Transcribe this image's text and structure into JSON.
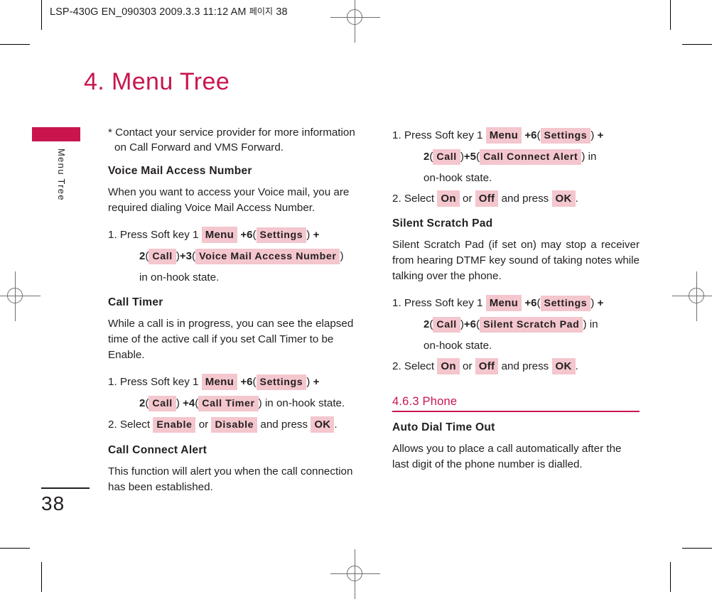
{
  "print_marks": {
    "registration_icon": "registration-crosshair-icon",
    "crop_icon": "crop-mark-icon"
  },
  "header": {
    "file_line": "LSP-430G EN_090303  2009.3.3 11:12 AM",
    "korean_page_label": "페이지",
    "page_ref": "38"
  },
  "chapter": {
    "title": "4. Menu Tree"
  },
  "side_tab": {
    "label": "Menu Tree",
    "bar_color": "#c8154d"
  },
  "folio": {
    "page_number": "38"
  },
  "colors": {
    "accent": "#c8154d",
    "highlight": "#f4c6cd",
    "text": "#231f20"
  },
  "left_column": {
    "note": "Contact your service provider for more information on Call Forward and VMS Forward.",
    "note_marker": "*",
    "sections": [
      {
        "heading": "Voice Mail Access Number",
        "body": "When you want to access your Voice mail, you are required dialing Voice Mail Access Number.",
        "step1": {
          "number": "1.",
          "lead": "Press Soft key 1",
          "k1": "Menu",
          "plus1": "+",
          "d1": "6",
          "open1": "(",
          "k2": "Settings",
          "close1": ")",
          "plus2": "+",
          "d2": "2",
          "open2": "(",
          "k3": "Call",
          "close2": ")",
          "plus3": "+",
          "d3": "3",
          "open3": "(",
          "k4": "Voice Mail Access Number",
          "close3": ")",
          "tail": "in on-hook state."
        }
      },
      {
        "heading": "Call Timer",
        "body": "While a call is in progress, you can see the elapsed time of the active call if you set Call Timer to be Enable.",
        "step1": {
          "number": "1.",
          "lead": "Press Soft key 1",
          "k1": "Menu",
          "plus1": "+",
          "d1": "6",
          "open1": "(",
          "k2": "Settings",
          "close1": ")",
          "plus2": "+",
          "d2": "2",
          "open2": "(",
          "k3": "Call",
          "close2": ")",
          "plus3": "+",
          "d3": "4",
          "open3": "(",
          "k4": "Call Timer",
          "close3": ")",
          "tail": "in on-hook state."
        },
        "step2": {
          "number": "2.",
          "lead": "Select",
          "opt1": "Enable",
          "or": "or",
          "opt2": "Disable",
          "mid": "and press",
          "confirm": "OK",
          "period": "."
        }
      },
      {
        "heading": "Call Connect Alert",
        "body": "This function will alert you when the call connection has been established."
      }
    ]
  },
  "right_column": {
    "continued_steps": {
      "step1": {
        "number": "1.",
        "lead": "Press Soft key 1",
        "k1": "Menu",
        "plus1": "+",
        "d1": "6",
        "open1": "(",
        "k2": "Settings",
        "close1": ")",
        "plus2": "+",
        "d2": "2",
        "open2": "(",
        "k3": "Call",
        "close2": ")",
        "plus3": "+",
        "d3": "5",
        "open3": "(",
        "k4": "Call Connect Alert",
        "close3": ")",
        "tail_inline": "in",
        "tail": "on-hook state."
      },
      "step2": {
        "number": "2.",
        "lead": "Select",
        "opt1": "On",
        "or": "or",
        "opt2": "Off",
        "mid": "and press",
        "confirm": "OK",
        "period": "."
      }
    },
    "sections": [
      {
        "heading": "Silent Scratch Pad",
        "body": "Silent Scratch Pad (if set on) may stop a receiver from hearing DTMF key sound of taking notes while talking over the phone.",
        "step1": {
          "number": "1.",
          "lead": "Press Soft key 1",
          "k1": "Menu",
          "plus1": "+",
          "d1": "6",
          "open1": "(",
          "k2": "Settings",
          "close1": ")",
          "plus2": "+",
          "d2": "2",
          "open2": "(",
          "k3": "Call",
          "close2": ")",
          "plus3": "+",
          "d3": "6",
          "open3": "(",
          "k4": "Silent Scratch Pad",
          "close3": ")",
          "tail_inline": "in",
          "tail": "on-hook state."
        },
        "step2": {
          "number": "2.",
          "lead": "Select",
          "opt1": "On",
          "or": "or",
          "opt2": "Off",
          "mid": "and press",
          "confirm": "OK",
          "period": "."
        }
      }
    ],
    "section_head": "4.6.3 Phone",
    "phone_section": {
      "heading": "Auto Dial Time Out",
      "body": "Allows you to place a call automatically after the last digit of the phone number is dialled."
    }
  }
}
